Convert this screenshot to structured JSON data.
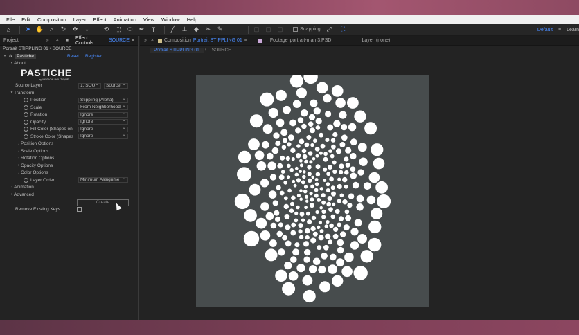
{
  "menu": [
    "File",
    "Edit",
    "Composition",
    "Layer",
    "Effect",
    "Animation",
    "View",
    "Window",
    "Help"
  ],
  "toolbar": {
    "snapping_label": "Snapping",
    "workspace_active": "Default",
    "workspace_next": "Learn",
    "menu_icon": "≡"
  },
  "left_panel": {
    "tab_project": "Project",
    "tab_effect_controls": "Effect Controls",
    "tab_effect_controls_target": "SOURCE",
    "breadcrumb": "Portrait STIPPLING 01 • SOURCE",
    "effect": {
      "badge": "fx",
      "name": "Pastiche",
      "reset": "Reset",
      "register": "Register..."
    },
    "about": "About",
    "logo_main": "PASTICHE",
    "logo_sub": "by MOTION BOUTIQUE",
    "source_layer": {
      "label": "Source Layer",
      "value": "1. SOU",
      "value2": "Source"
    },
    "transform": "Transform",
    "properties": [
      {
        "label": "Position",
        "value": "Stippling (Alpha)"
      },
      {
        "label": "Scale",
        "value": "From Neighborhood"
      },
      {
        "label": "Rotation",
        "value": "Ignore"
      },
      {
        "label": "Opacity",
        "value": "Ignore"
      },
      {
        "label": "Fill Color (Shapes on",
        "value": "Ignore"
      },
      {
        "label": "Stroke Color (Shapes",
        "value": "Ignore"
      }
    ],
    "option_groups": [
      "Position Options",
      "Scale Options",
      "Rotation Options",
      "Opacity Options",
      "Color Options"
    ],
    "layer_order": {
      "label": "Layer Order",
      "value": "Minimum Assignme"
    },
    "animation": "Animation",
    "advanced": "Advanced",
    "create_button": "Create",
    "remove_keys": "Remove Existing Keys"
  },
  "right_panel": {
    "tab_composition": "Composition",
    "tab_composition_name": "Portrait STIPPLING 01",
    "tab_footage": "Footage",
    "tab_footage_name": "portrait-man 3.PSD",
    "tab_layer": "Layer",
    "tab_layer_value": "(none)",
    "sub_tabs": [
      "Portrait STIPPLING 01",
      "SOURCE"
    ]
  },
  "colors": {
    "accent": "#4a8cff",
    "panel_bg": "#232323",
    "canvas_bg": "#474c4d",
    "dot": "#ffffff"
  },
  "icons": [
    "home-icon",
    "select-icon",
    "hand-icon",
    "zoom-icon",
    "orbit-icon",
    "pan-icon",
    "dolly-icon",
    "rotate-icon",
    "region-icon",
    "ellipse-icon",
    "pen-icon",
    "type-icon",
    "brush-icon",
    "clone-icon",
    "eraser-icon",
    "roto-icon",
    "pin-icon"
  ]
}
